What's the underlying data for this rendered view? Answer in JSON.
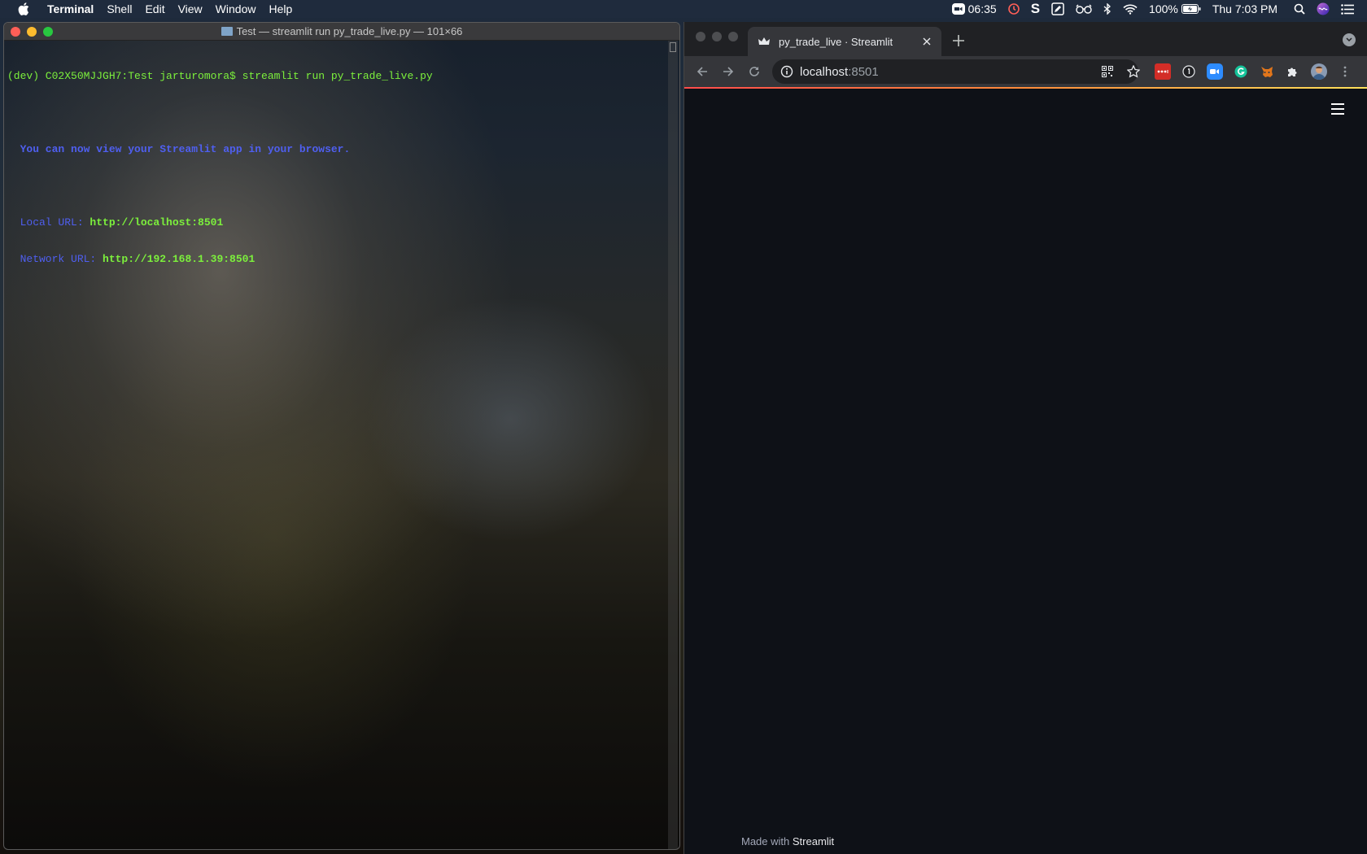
{
  "menubar": {
    "app_name": "Terminal",
    "items": [
      "Shell",
      "Edit",
      "View",
      "Window",
      "Help"
    ],
    "zoom_timer": "06:35",
    "battery": "100%",
    "clock": "Thu 7:03 PM"
  },
  "terminal": {
    "title": "Test — streamlit run py_trade_live.py — 101×66",
    "prompt_line": "(dev) C02X50MJJGH7:Test jarturomora$ streamlit run py_trade_live.py",
    "view_message": "  You can now view your Streamlit app in your browser.",
    "local_label": "  Local URL: ",
    "local_url": "http://localhost:8501",
    "network_label": "  Network URL: ",
    "network_url": "http://192.168.1.39:8501"
  },
  "browser": {
    "tab_title": "py_trade_live · Streamlit",
    "address_host": "localhost",
    "address_port": ":8501",
    "footer_prefix": "Made with ",
    "footer_brand": "Streamlit"
  },
  "colors": {
    "terminal_green": "#7cf03c",
    "terminal_blue": "#4f5ff0",
    "streamlit_bg": "#0e1117",
    "progress_gradient": [
      "#ff4b4b",
      "#ffe15a"
    ]
  },
  "icons": {
    "menubar": [
      "apple-icon",
      "zoom-video-icon",
      "timer-icon",
      "s-icon",
      "edit-app-icon",
      "glasses-icon",
      "bluetooth-icon",
      "wifi-icon",
      "battery-icon",
      "spotlight-search-icon",
      "siri-icon",
      "notification-center-icon"
    ],
    "browser_toolbar": [
      "back-arrow-icon",
      "forward-arrow-icon",
      "reload-icon",
      "info-icon",
      "qr-code-icon",
      "bookmark-star-icon"
    ],
    "extensions": [
      "lastpass-icon",
      "onepassword-icon",
      "zoom-extension-icon",
      "grammarly-icon",
      "metamask-icon",
      "puzzle-extensions-icon",
      "profile-avatar-icon",
      "kebab-menu-icon"
    ]
  }
}
